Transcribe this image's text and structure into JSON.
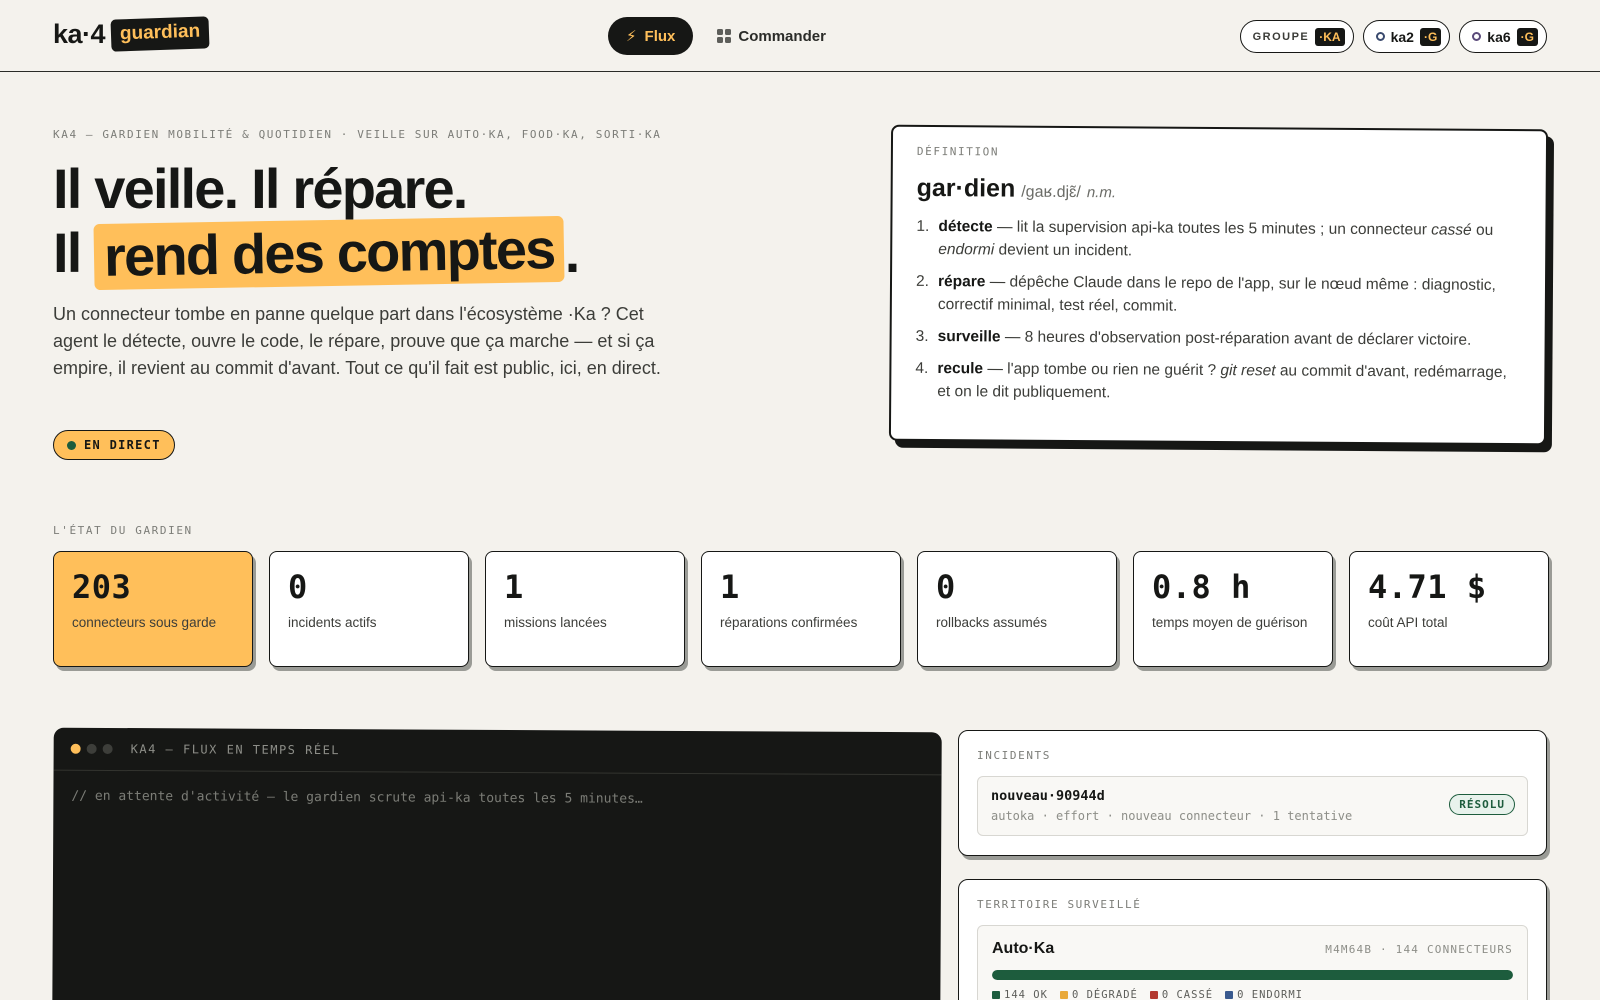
{
  "header": {
    "logo_text": "ka·4",
    "logo_badge": "guardian",
    "nav": {
      "flux_label": "Flux",
      "commander_label": "Commander"
    },
    "chips": [
      {
        "label": "GROUPE",
        "tag": "·KA"
      },
      {
        "label": "ka2",
        "tag": "·G"
      },
      {
        "label": "ka6",
        "tag": "·G"
      }
    ]
  },
  "hero": {
    "eyebrow": "KA4 — GARDIEN MOBILITÉ & QUOTIDIEN · VEILLE SUR AUTO·KA, FOOD·KA, SORTI·KA",
    "title_line1": "Il veille. Il répare.",
    "title_line2_pre": "Il ",
    "title_line2_highlight": "rend des comptes",
    "title_line2_post": ".",
    "lead": "Un connecteur tombe en panne quelque part dans l'écosystème ·Ka ? Cet agent le détecte, ouvre le code, le répare, prouve que ça marche — et si ça empire, il revient au commit d'avant. Tout ce qu'il fait est public, ici, en direct.",
    "live_label": "EN DIRECT"
  },
  "definition": {
    "label": "DÉFINITION",
    "word": "gar·dien",
    "phonetic": "/gaʁ.djɛ̃/",
    "pos": "n.m.",
    "items": [
      {
        "num": "1.",
        "term": "détecte",
        "pre": " — lit la supervision api-ka toutes les 5 minutes ; un connecteur ",
        "em1": "cassé",
        "mid": " ou ",
        "em2": "endormi",
        "post": " devient un incident."
      },
      {
        "num": "2.",
        "term": "répare",
        "text": " — dépêche Claude dans le repo de l'app, sur le nœud même : diagnostic, correctif minimal, test réel, commit."
      },
      {
        "num": "3.",
        "term": "surveille",
        "text": " — 8 heures d'observation post-réparation avant de déclarer victoire."
      },
      {
        "num": "4.",
        "term": "recule",
        "pre": " — l'app tombe ou rien ne guérit ? ",
        "em1": "git reset",
        "post": " au commit d'avant, redémarrage, et on le dit publiquement."
      }
    ]
  },
  "stats": {
    "label": "L'ÉTAT DU GARDIEN",
    "items": [
      {
        "value": "203",
        "label": "connecteurs sous garde"
      },
      {
        "value": "0",
        "label": "incidents actifs"
      },
      {
        "value": "1",
        "label": "missions lancées"
      },
      {
        "value": "1",
        "label": "réparations confirmées"
      },
      {
        "value": "0",
        "label": "rollbacks assumés"
      },
      {
        "value": "0.8 h",
        "label": "temps moyen de guérison"
      },
      {
        "value": "4.71 $",
        "label": "coût API total"
      }
    ]
  },
  "terminal": {
    "title": "KA4 — FLUX EN TEMPS RÉEL",
    "placeholder": "// en attente d'activité — le gardien scrute api-ka toutes les 5 minutes…"
  },
  "incidents": {
    "label": "INCIDENTS",
    "items": [
      {
        "title": "nouveau·90944d",
        "meta": "autoka · effort · nouveau connecteur · 1 tentative",
        "status": "RÉSOLU"
      }
    ]
  },
  "territory": {
    "label": "TERRITOIRE SURVEILLÉ",
    "items": [
      {
        "name": "Auto·Ka",
        "meta": "M4M64B · 144 CONNECTEURS",
        "ok_fraction": 1.0,
        "legend": [
          {
            "label": "144 OK",
            "color": "#1d5c3d"
          },
          {
            "label": "0 DÉGRADÉ",
            "color": "#e9a93a"
          },
          {
            "label": "0 CASSÉ",
            "color": "#b3392f"
          },
          {
            "label": "0 ENDORMI",
            "color": "#3a5a8e"
          }
        ]
      }
    ]
  },
  "colors": {
    "accent": "#ffbf5a",
    "ink": "#161715",
    "ok": "#1d5c3d"
  }
}
